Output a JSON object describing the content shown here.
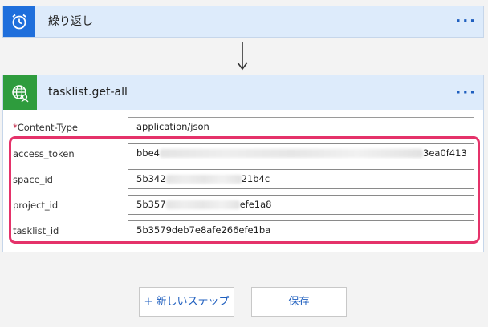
{
  "trigger": {
    "title": "繰り返し",
    "icon": "alarm-clock-icon",
    "accent": "#1f6fdc"
  },
  "action": {
    "title": "tasklist.get-all",
    "icon": "globe-user-icon",
    "accent": "#2e9c3d",
    "fields": [
      {
        "label": "Content-Type",
        "required": true,
        "value_start": "application/json",
        "value_end": ""
      },
      {
        "label": "access_token",
        "required": false,
        "value_start": "bbe4",
        "value_end": "3ea0f413"
      },
      {
        "label": "space_id",
        "required": false,
        "value_start": "5b342",
        "value_end": "21b4c"
      },
      {
        "label": "project_id",
        "required": false,
        "value_start": "5b357",
        "value_end": "efe1a8"
      },
      {
        "label": "tasklist_id",
        "required": false,
        "value_start": "5b3579deb7e8afe266efe1ba",
        "value_end": ""
      }
    ]
  },
  "buttons": {
    "new_step": "+ 新しいステップ",
    "save": "保存"
  },
  "colors": {
    "highlight": "#e5326a",
    "link": "#1f5fbf"
  }
}
